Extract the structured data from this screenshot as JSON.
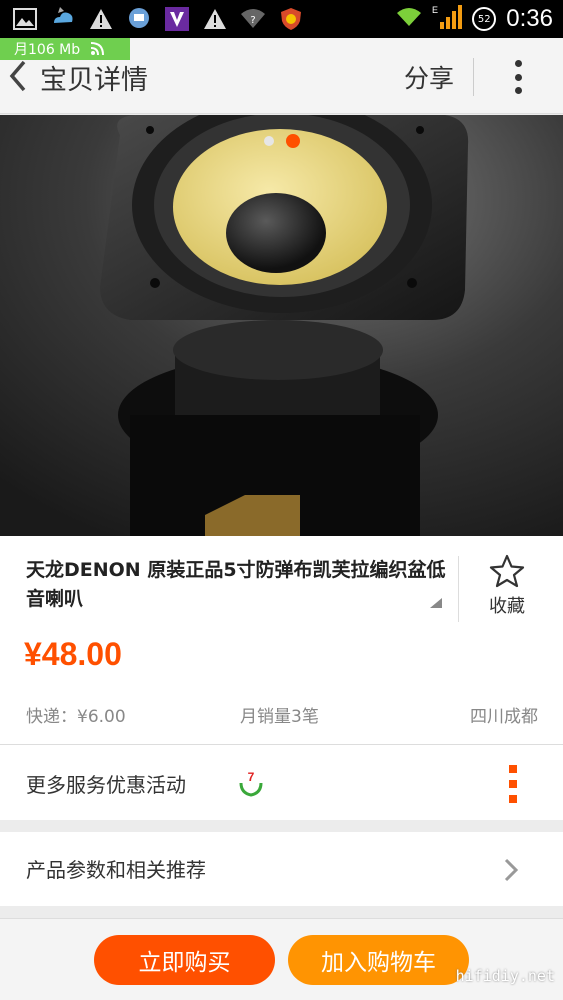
{
  "status_bar": {
    "time": "0:36",
    "battery": "52",
    "network": "E",
    "left_icons": [
      "gallery-icon",
      "weather-icon",
      "warning-icon",
      "chat-icon",
      "v-app-icon",
      "warning-icon",
      "wifi-question-icon",
      "shield-icon"
    ]
  },
  "data_usage": {
    "label": "月106 Mb"
  },
  "header": {
    "title": "宝贝详情",
    "share_label": "分享"
  },
  "carousel": {
    "count": 2,
    "active_index": 1
  },
  "product": {
    "title": "天龙DENON 原装正品5寸防弹布凯芙拉编织盆低音喇叭",
    "favorite_label": "收藏",
    "price": "¥48.00",
    "shipping": "快递：¥6.00",
    "monthly_sales": "月销量3笔",
    "location": "四川成都"
  },
  "services": {
    "label": "更多服务优惠活动",
    "promo_badge": "7"
  },
  "params": {
    "label": "产品参数和相关推荐"
  },
  "bottom_bar": {
    "buy_label": "立即购买",
    "cart_label": "加入购物车",
    "watermark": "hifidiy.net"
  },
  "colors": {
    "accent": "#ff5000",
    "cart": "#ff9402",
    "data_pill": "#6fcf4f"
  }
}
